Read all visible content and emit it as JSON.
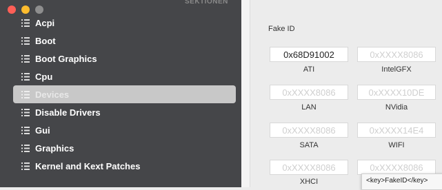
{
  "sidebar": {
    "header": "SEKTIONEN",
    "traffic_lights": {
      "close": "#ff5f57",
      "minimize": "#febc2e",
      "zoom": "#8e8e8e"
    },
    "items": [
      {
        "label": "Acpi",
        "icon": "list-icon"
      },
      {
        "label": "Boot",
        "icon": "list-icon"
      },
      {
        "label": "Boot Graphics",
        "icon": "list-icon"
      },
      {
        "label": "Cpu",
        "icon": "list-icon"
      },
      {
        "label": "Devices",
        "icon": "list-icon",
        "selected": true
      },
      {
        "label": "Disable Drivers",
        "icon": "list-icon"
      },
      {
        "label": "Gui",
        "icon": "list-icon"
      },
      {
        "label": "Graphics",
        "icon": "list-icon"
      },
      {
        "label": "Kernel and Kext Patches",
        "icon": "list-icon"
      }
    ]
  },
  "main": {
    "section_label": "Fake ID",
    "fields": [
      {
        "value": "0x68D91002",
        "placeholder": "",
        "caption": "ATI"
      },
      {
        "value": "",
        "placeholder": "0xXXXX8086",
        "caption": "IntelGFX"
      },
      {
        "value": "",
        "placeholder": "0xXXXX8086",
        "caption": "LAN"
      },
      {
        "value": "",
        "placeholder": "0xXXXX10DE",
        "caption": "NVidia"
      },
      {
        "value": "",
        "placeholder": "0xXXXX8086",
        "caption": "SATA"
      },
      {
        "value": "",
        "placeholder": "0xXXXX14E4",
        "caption": "WIFI"
      },
      {
        "value": "",
        "placeholder": "0xXXXX8086",
        "caption": "XHCI"
      },
      {
        "value": "",
        "placeholder": "0xXXXX8086",
        "caption": ""
      }
    ],
    "tooltip": "<key>FakeID</key>"
  }
}
